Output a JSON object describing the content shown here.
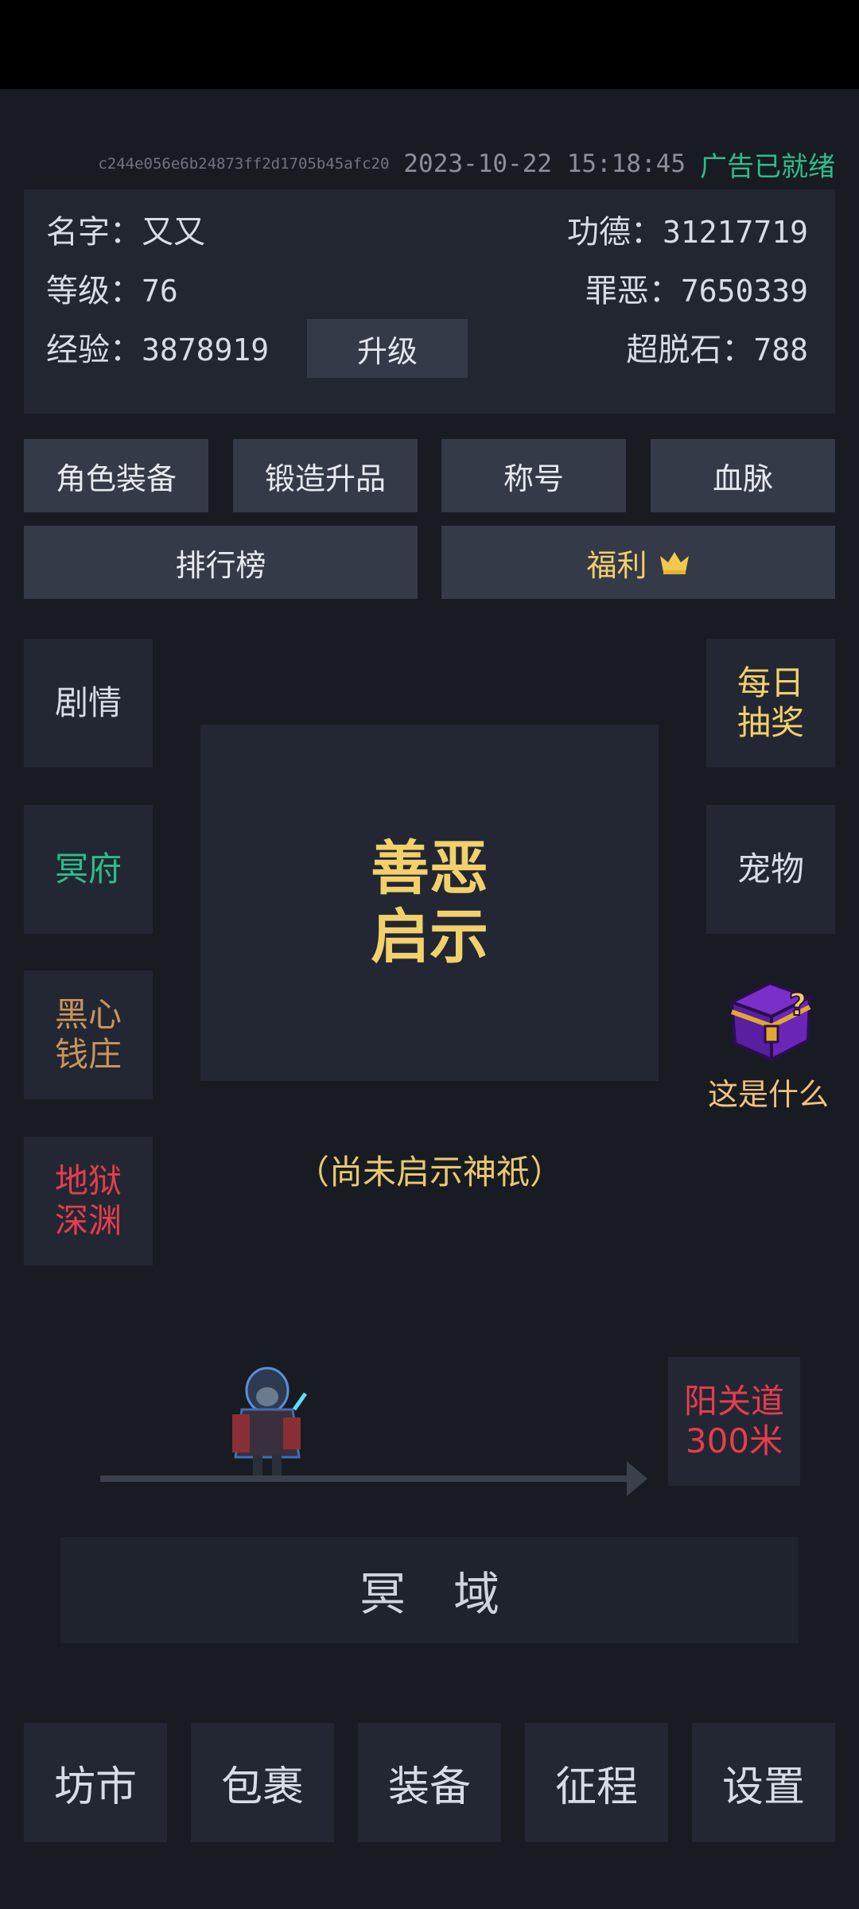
{
  "header": {
    "hash": "c244e056e6b24873ff2d1705b45afc20",
    "datetime": "2023-10-22 15:18:45",
    "ad_status": "广告已就绪"
  },
  "profile": {
    "name_label": "名字：",
    "name": "又又",
    "level_label": "等级：",
    "level": "76",
    "exp_label": "经验：",
    "exp": "3878919",
    "upgrade_label": "升级",
    "merit_label": "功德：",
    "merit": "31217719",
    "sin_label": "罪恶：",
    "sin": "7650339",
    "stone_label": "超脱石：",
    "stone": "788"
  },
  "top_buttons": {
    "equipment": "角色装备",
    "forge": "锻造升品",
    "title": "称号",
    "bloodline": "血脉",
    "ranking": "排行榜",
    "welfare": "福利"
  },
  "left_menu": {
    "story": "剧情",
    "underworld": "冥府",
    "bank_line1": "黑心",
    "bank_line2": "钱庄",
    "abyss_line1": "地狱",
    "abyss_line2": "深渊"
  },
  "right_menu": {
    "lottery_line1": "每日",
    "lottery_line2": "抽奖",
    "pet": "宠物",
    "mystery_label": "这是什么"
  },
  "center": {
    "title_line1": "善恶",
    "title_line2": "启示",
    "note": "（尚未启示神祇）"
  },
  "journey": {
    "dest_line1": "阳关道",
    "dest_line2": "300米",
    "realm": "冥域"
  },
  "bottom_nav": {
    "market": "坊市",
    "bag": "包裹",
    "gear": "装备",
    "expedition": "征程",
    "settings": "设置"
  },
  "colors": {
    "background": "#181b22",
    "panel": "#222631",
    "button": "#353a48",
    "gold": "#f2d06b",
    "green": "#2dbd8a",
    "red": "#e53d4e",
    "brown": "#c9955a",
    "orange": "#f0c27a"
  },
  "icons": {
    "welfare": "crown-icon",
    "mystery": "mystery-chest-icon",
    "player": "player-sprite"
  }
}
